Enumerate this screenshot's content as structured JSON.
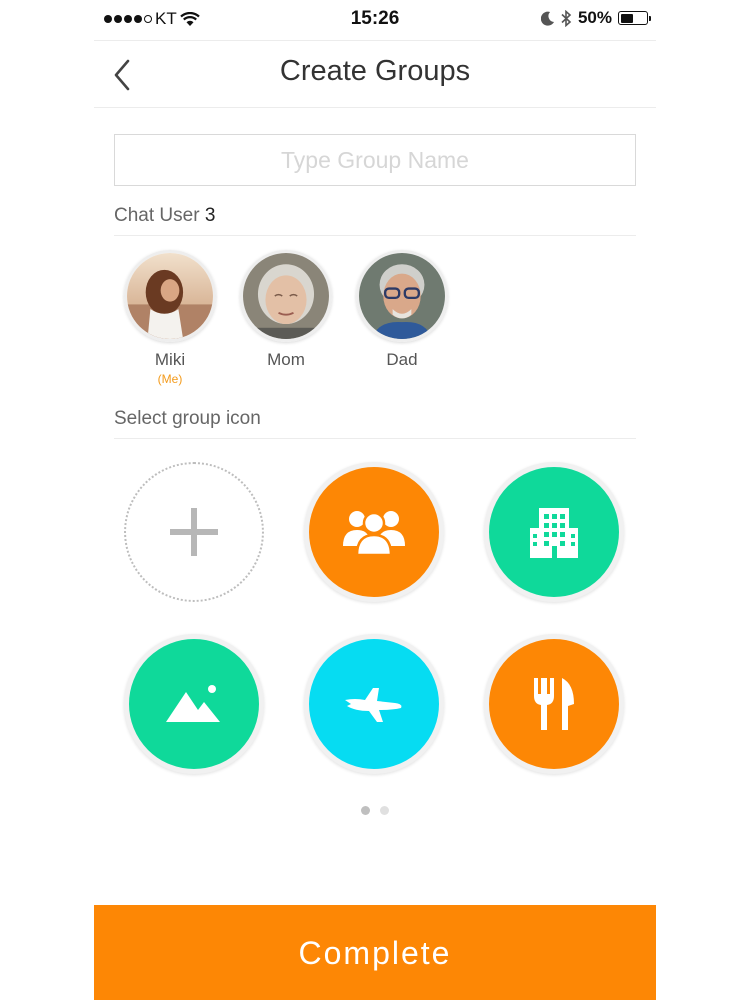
{
  "status_bar": {
    "carrier": "KT",
    "time": "15:26",
    "battery": "50%",
    "battery_level": 0.5
  },
  "nav": {
    "title": "Create Groups",
    "back_icon": "chevron-left-icon"
  },
  "group_name": {
    "value": "",
    "placeholder": "Type Group Name"
  },
  "chat_user": {
    "label": "Chat User",
    "count": "3"
  },
  "users": [
    {
      "name": "Miki",
      "tag": "(Me)"
    },
    {
      "name": "Mom",
      "tag": ""
    },
    {
      "name": "Dad",
      "tag": ""
    }
  ],
  "select_icon": {
    "label": "Select group icon"
  },
  "group_icons": [
    {
      "icon": "plus-icon",
      "color": "#ffffff"
    },
    {
      "icon": "people-icon",
      "color": "#fd8705"
    },
    {
      "icon": "building-icon",
      "color": "#0fd99a"
    },
    {
      "icon": "mountain-icon",
      "color": "#0fd99a"
    },
    {
      "icon": "airplane-icon",
      "color": "#06dcf2"
    },
    {
      "icon": "fork-knife-icon",
      "color": "#fd8705"
    }
  ],
  "pager": {
    "pages": 2,
    "current": 1
  },
  "complete_label": "Complete",
  "colors": {
    "accent": "#fd8705",
    "green": "#0fd99a",
    "cyan": "#06dcf2"
  }
}
